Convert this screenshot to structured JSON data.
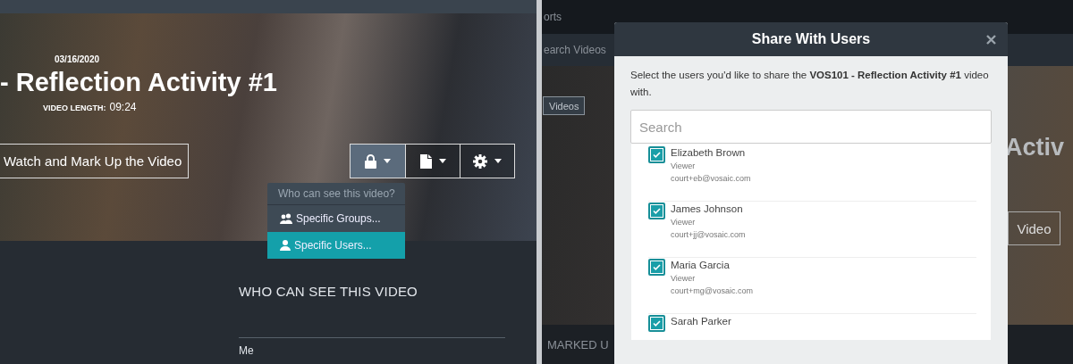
{
  "left_screen": {
    "hero": {
      "date": "03/16/2020",
      "title": "- Reflection Activity #1",
      "length_label": "VIDEO LENGTH:",
      "length_value": "09:24",
      "watch_button": "Watch and Mark Up the Video",
      "toolbar": [
        {
          "kind": "lock",
          "selected": true
        },
        {
          "kind": "document",
          "selected": false
        },
        {
          "kind": "gear",
          "selected": false
        }
      ]
    },
    "visibility_menu": {
      "header": "Who can see this video?",
      "items": [
        {
          "kind": "groups",
          "label": "Specific Groups...",
          "selected": false
        },
        {
          "kind": "user",
          "label": "Specific Users...",
          "selected": true
        }
      ]
    },
    "section_title": "WHO CAN SEE THIS VIDEO",
    "viewers": [
      "Me"
    ]
  },
  "right_screen": {
    "background": {
      "nav_text": "orts",
      "search_text": "earch Videos",
      "videos_button": "Videos",
      "title_fragment": "Activ",
      "video_button": "Video",
      "section_fragment": "MARKED U"
    },
    "dialog": {
      "title": "Share With Users",
      "intro": "Select the users you'd like to share the **VOS101 - Reflection Activity #1** video with.",
      "search_placeholder": "Search",
      "users": [
        {
          "name": "Elizabeth Brown",
          "role": "Viewer",
          "email": "court+eb@vosaic.com",
          "checked": true
        },
        {
          "name": "James Johnson",
          "role": "Viewer",
          "email": "court+jj@vosaic.com",
          "checked": true
        },
        {
          "name": "Maria Garcia",
          "role": "Viewer",
          "email": "court+mg@vosaic.com",
          "checked": true
        },
        {
          "name": "Sarah Parker",
          "checked": true
        }
      ]
    }
  }
}
